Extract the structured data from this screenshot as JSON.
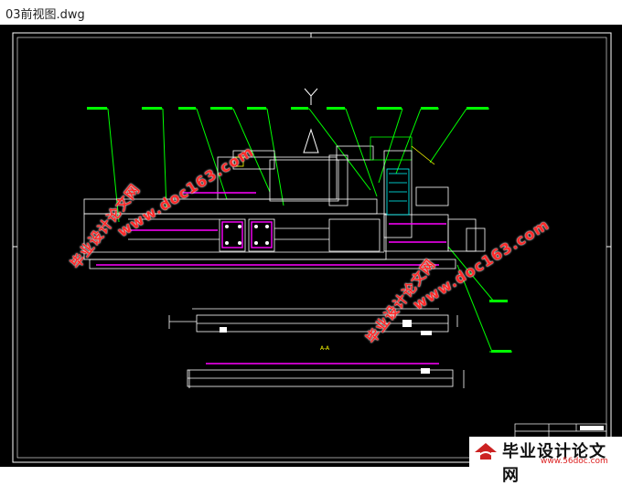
{
  "window": {
    "title": "03前视图.dwg"
  },
  "watermark": {
    "text_cn": "毕业设计论文网",
    "text_url": "www.doc163.com"
  },
  "logo": {
    "text_cn": "毕业设计论文网",
    "text_url": "www.56doc.com"
  },
  "colors": {
    "background": "#000000",
    "frame": "#ffffff",
    "leader": "#00ff00",
    "drawing": "#ffffff",
    "accent": "#ff00ff",
    "cyan": "#00ffff",
    "yellow": "#ffff00",
    "watermark": "#ff2a2a"
  }
}
